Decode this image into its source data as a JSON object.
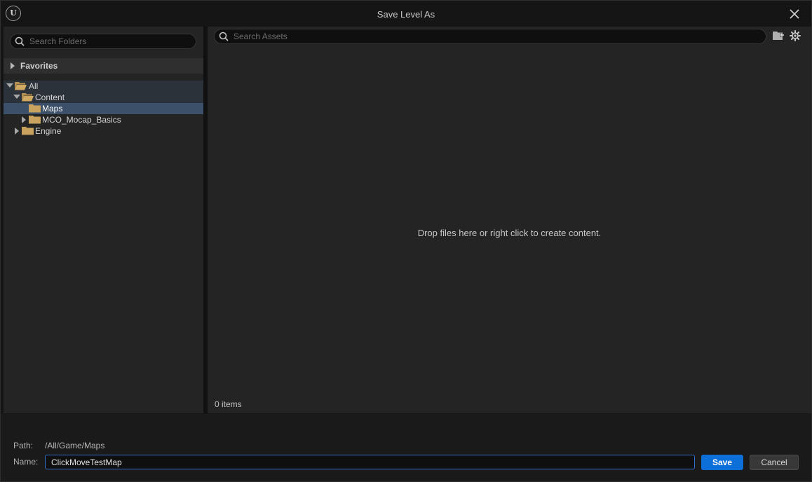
{
  "window": {
    "title": "Save Level As",
    "logo_text": "U"
  },
  "left_panel": {
    "search_placeholder": "Search Folders",
    "favorites_label": "Favorites",
    "tree": [
      {
        "label": "All",
        "depth": 0,
        "expanded": true
      },
      {
        "label": "Content",
        "depth": 1,
        "expanded": true
      },
      {
        "label": "Maps",
        "depth": 2,
        "selected": true
      },
      {
        "label": "MCO_Mocap_Basics",
        "depth": 2,
        "expanded": false
      },
      {
        "label": "Engine",
        "depth": 1,
        "expanded": false
      }
    ]
  },
  "right_panel": {
    "search_placeholder": "Search Assets",
    "empty_message": "Drop files here or right click to create content.",
    "item_count": "0 items"
  },
  "bottom": {
    "path_label": "Path:",
    "path_value": "/All/Game/Maps",
    "name_label": "Name:",
    "name_value": "ClickMoveTestMap",
    "save_label": "Save",
    "cancel_label": "Cancel"
  },
  "colors": {
    "accent": "#0d6fd8",
    "folder": "#c9a35e",
    "selection": "#3c5069"
  }
}
